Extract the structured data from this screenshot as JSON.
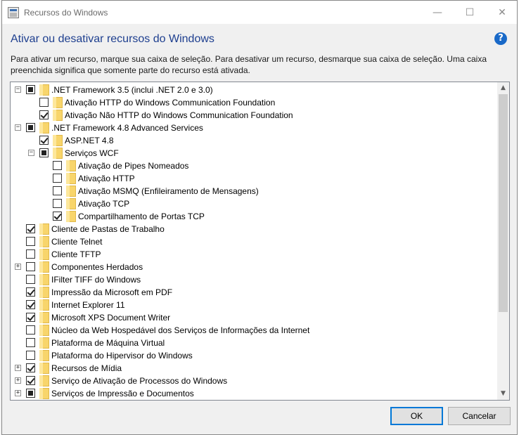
{
  "window": {
    "title": "Recursos do Windows",
    "minimize_glyph": "—",
    "maximize_glyph": "☐",
    "close_glyph": "✕"
  },
  "header": {
    "heading": "Ativar ou desativar recursos do Windows",
    "help_glyph": "?",
    "description": "Para ativar um recurso, marque sua caixa de seleção. Para desativar um recurso, desmarque sua caixa de seleção. Uma caixa preenchida significa que somente parte do recurso está ativada."
  },
  "tree": {
    "items": [
      {
        "label": ".NET Framework 3.5 (inclui .NET 2.0 e 3.0)",
        "level": 0,
        "state": "partial",
        "expander": "−"
      },
      {
        "label": "Ativação HTTP do Windows Communication Foundation",
        "level": 1,
        "state": "unchecked",
        "expander": ""
      },
      {
        "label": "Ativação Não HTTP do Windows Communication Foundation",
        "level": 1,
        "state": "checked",
        "expander": ""
      },
      {
        "label": ".NET Framework 4.8 Advanced Services",
        "level": 0,
        "state": "partial",
        "expander": "−"
      },
      {
        "label": "ASP.NET 4.8",
        "level": 1,
        "state": "checked",
        "expander": ""
      },
      {
        "label": "Serviços WCF",
        "level": 1,
        "state": "partial",
        "expander": "−"
      },
      {
        "label": "Ativação de Pipes Nomeados",
        "level": 2,
        "state": "unchecked",
        "expander": ""
      },
      {
        "label": "Ativação HTTP",
        "level": 2,
        "state": "unchecked",
        "expander": ""
      },
      {
        "label": "Ativação MSMQ (Enfileiramento de Mensagens)",
        "level": 2,
        "state": "unchecked",
        "expander": ""
      },
      {
        "label": "Ativação TCP",
        "level": 2,
        "state": "unchecked",
        "expander": ""
      },
      {
        "label": "Compartilhamento de Portas TCP",
        "level": 2,
        "state": "checked",
        "expander": ""
      },
      {
        "label": "Cliente de Pastas de Trabalho",
        "level": 0,
        "state": "checked",
        "expander": ""
      },
      {
        "label": "Cliente Telnet",
        "level": 0,
        "state": "unchecked",
        "expander": ""
      },
      {
        "label": "Cliente TFTP",
        "level": 0,
        "state": "unchecked",
        "expander": ""
      },
      {
        "label": "Componentes Herdados",
        "level": 0,
        "state": "unchecked",
        "expander": "+"
      },
      {
        "label": "IFilter TIFF do Windows",
        "level": 0,
        "state": "unchecked",
        "expander": ""
      },
      {
        "label": "Impressão da Microsoft em PDF",
        "level": 0,
        "state": "checked",
        "expander": ""
      },
      {
        "label": "Internet Explorer 11",
        "level": 0,
        "state": "checked",
        "expander": ""
      },
      {
        "label": "Microsoft XPS Document Writer",
        "level": 0,
        "state": "checked",
        "expander": ""
      },
      {
        "label": "Núcleo da Web Hospedável dos Serviços de Informações da Internet",
        "level": 0,
        "state": "unchecked",
        "expander": ""
      },
      {
        "label": "Plataforma de Máquina Virtual",
        "level": 0,
        "state": "unchecked",
        "expander": ""
      },
      {
        "label": "Plataforma do Hipervisor do Windows",
        "level": 0,
        "state": "unchecked",
        "expander": ""
      },
      {
        "label": "Recursos de Mídia",
        "level": 0,
        "state": "checked",
        "expander": "+"
      },
      {
        "label": "Serviço de Ativação de Processos do Windows",
        "level": 0,
        "state": "checked",
        "expander": "+"
      },
      {
        "label": "Serviços de Impressão e Documentos",
        "level": 0,
        "state": "partial",
        "expander": "+"
      }
    ],
    "scroll_up_glyph": "▲",
    "scroll_down_glyph": "▼"
  },
  "footer": {
    "ok_label": "OK",
    "cancel_label": "Cancelar"
  }
}
